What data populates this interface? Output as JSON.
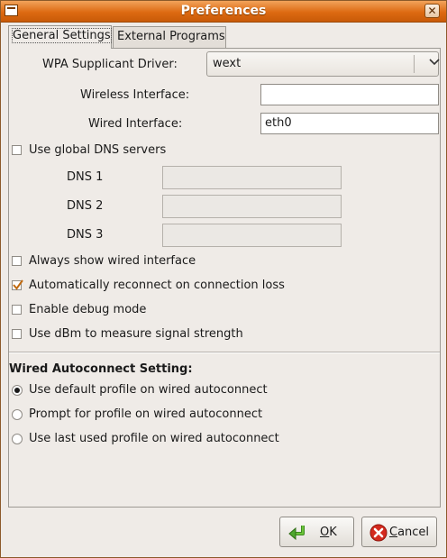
{
  "window": {
    "title": "Preferences",
    "close_glyph": "✕"
  },
  "tabs": [
    {
      "label": "General Settings"
    },
    {
      "label": "External Programs"
    }
  ],
  "general": {
    "wpa_driver_label": "WPA Supplicant Driver:",
    "wpa_driver_value": "wext",
    "wireless_interface_label": "Wireless Interface:",
    "wireless_interface_value": "",
    "wired_interface_label": "Wired Interface:",
    "wired_interface_value": "eth0",
    "global_dns_label": "Use global DNS servers",
    "global_dns_checked": false,
    "dns1_label": "DNS 1",
    "dns1_value": "",
    "dns2_label": "DNS 2",
    "dns2_value": "",
    "dns3_label": "DNS 3",
    "dns3_value": "",
    "always_show_wired_label": "Always show wired interface",
    "always_show_wired_checked": false,
    "auto_reconnect_label": "Automatically reconnect on connection loss",
    "auto_reconnect_checked": true,
    "debug_mode_label": "Enable debug mode",
    "debug_mode_checked": false,
    "use_dbm_label": "Use dBm to measure signal strength",
    "use_dbm_checked": false
  },
  "wired_autoconnect": {
    "title": "Wired Autoconnect Setting:",
    "options": [
      {
        "label": "Use default profile on wired autoconnect",
        "selected": true
      },
      {
        "label": "Prompt for profile on wired autoconnect",
        "selected": false
      },
      {
        "label": "Use last used profile on wired autoconnect",
        "selected": false
      }
    ]
  },
  "buttons": {
    "ok_mnemonic": "O",
    "ok_rest": "K",
    "cancel_mnemonic": "C",
    "cancel_rest": "ancel"
  },
  "colors": {
    "titlebar": "#dd6a12",
    "ok_icon": "#4ea72e",
    "cancel_icon": "#d42a1e"
  },
  "icons": {
    "ok": "green-return-arrow-icon",
    "cancel": "red-x-circle-icon",
    "window": "window-menu-icon",
    "close": "close-icon"
  }
}
